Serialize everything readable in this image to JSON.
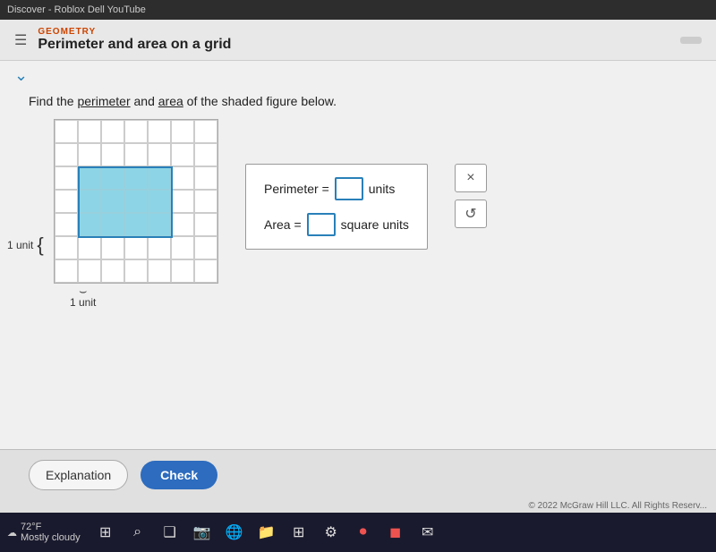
{
  "browser": {
    "bar_text": "Discover - Roblox    Dell    YouTube"
  },
  "header": {
    "subject": "GEOMETRY",
    "title": "Perimeter and area on a grid",
    "hamburger": "☰"
  },
  "question": {
    "text_before": "Find the ",
    "perimeter_link": "perimeter",
    "text_middle": " and ",
    "area_link": "area",
    "text_after": " of the shaded figure below."
  },
  "grid": {
    "cols": 7,
    "rows": 7,
    "unit_label_left": "1 unit",
    "unit_label_bottom": "1 unit"
  },
  "inputs": {
    "perimeter_label": "Perimeter =",
    "perimeter_unit": "units",
    "area_label": "Area =",
    "area_unit": "square units",
    "perimeter_value": "",
    "area_value": ""
  },
  "buttons": {
    "close_label": "×",
    "undo_label": "↺",
    "explanation_label": "Explanation",
    "check_label": "Check"
  },
  "copyright": "© 2022 McGraw Hill LLC. All Rights Reserv...",
  "taskbar": {
    "temp": "72°F",
    "weather": "Mostly cloudy"
  }
}
